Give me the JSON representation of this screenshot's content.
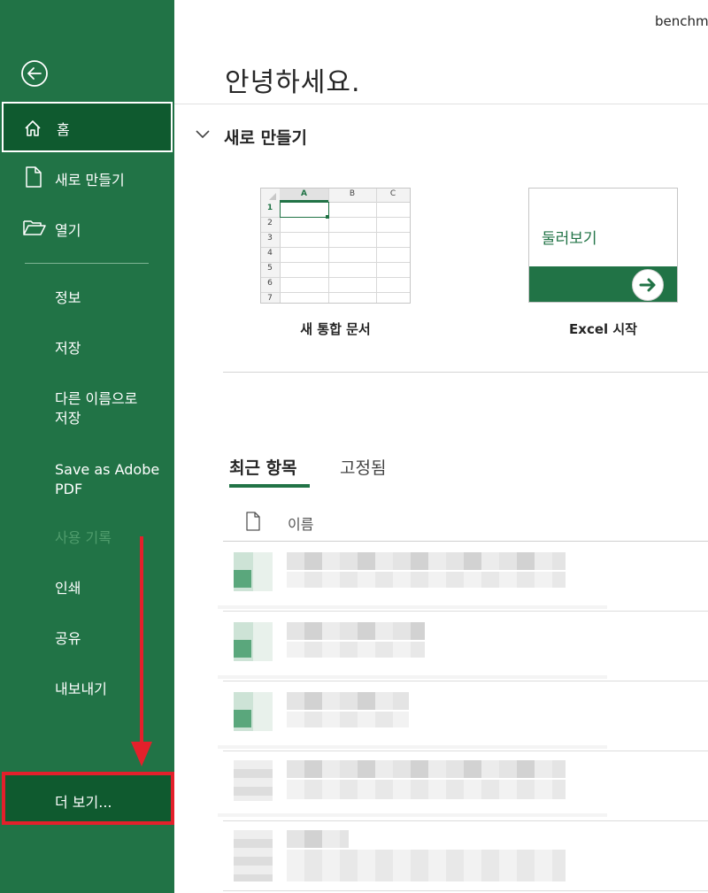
{
  "account": {
    "name": "benchm"
  },
  "greeting": "안녕하세요.",
  "sidebar": {
    "back_icon": "back-arrow-icon",
    "primary": [
      {
        "label": "홈",
        "icon": "home-icon"
      },
      {
        "label": "새로 만들기",
        "icon": "new-document-icon"
      },
      {
        "label": "열기",
        "icon": "open-folder-icon"
      }
    ],
    "secondary": [
      {
        "label": "정보"
      },
      {
        "label": "저장"
      },
      {
        "label": "다른 이름으로\n저장"
      },
      {
        "label": "Save as Adobe\nPDF"
      },
      {
        "label": "사용 기록"
      },
      {
        "label": "인쇄"
      },
      {
        "label": "공유"
      },
      {
        "label": "내보내기"
      }
    ],
    "more": "더 보기..."
  },
  "new_section": {
    "title": "새로 만들기",
    "templates": [
      {
        "label": "새 통합 문서",
        "columns": [
          "A",
          "B",
          "C"
        ],
        "rows": [
          "1",
          "2",
          "3",
          "4",
          "5",
          "6",
          "7"
        ]
      },
      {
        "label": "Excel 시작",
        "preview_text": "둘러보기"
      }
    ]
  },
  "recent": {
    "tabs": [
      "최근 항목",
      "고정됨"
    ],
    "active_tab": 0,
    "column_header": "이름"
  },
  "colors": {
    "sidebar": "#217346",
    "selected": "#0f5a2f",
    "highlight": "#e3202b",
    "accent": "#217346"
  }
}
